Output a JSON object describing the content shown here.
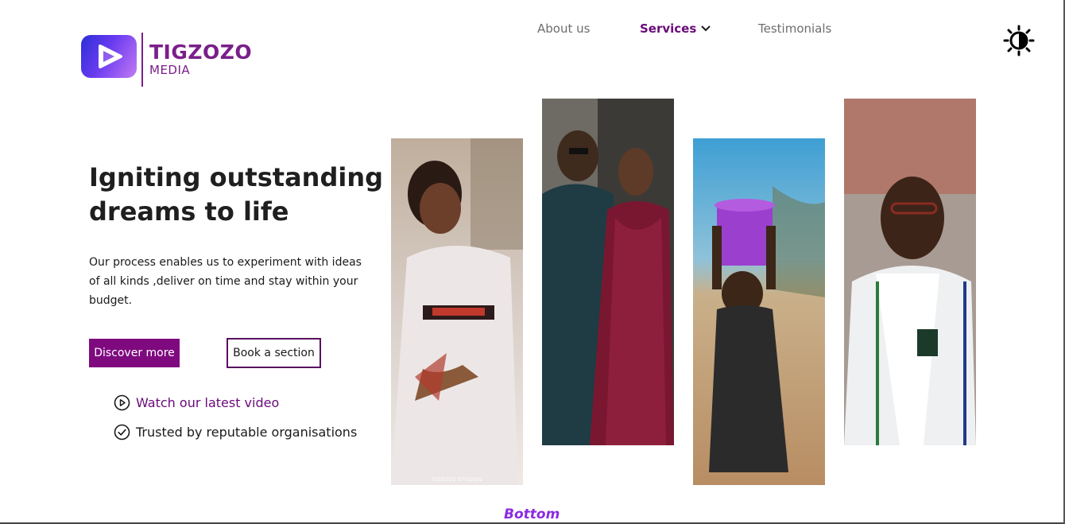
{
  "brand": {
    "name": "TIGZOZO",
    "sub": "MEDIA",
    "color": "#7a1f8a"
  },
  "nav": {
    "items": [
      {
        "label": "About us"
      },
      {
        "label": "Services"
      },
      {
        "label": "Testimonials"
      }
    ],
    "active_color": "#6a0a7a",
    "services_icon": "chevron-down-icon"
  },
  "theme_toggle": {
    "icon": "sun-contrast-icon"
  },
  "hero": {
    "title": "Igniting outstanding dreams to life",
    "description": "Our process enables us to experiment with ideas of all kinds ,deliver on time and stay within your budget.",
    "primary_button": "Discover more",
    "secondary_button": "Book a section",
    "primary_color": "#7f0a7f"
  },
  "features": {
    "watch": {
      "label": "Watch our latest video",
      "icon": "play-circle-icon"
    },
    "trusted": {
      "label": "Trusted by reputable organisations",
      "icon": "check-circle-icon"
    }
  },
  "gallery": {
    "watermark": "TIGZOZO STUDIOS",
    "photos": [
      {
        "subject": "bride-portrait"
      },
      {
        "subject": "couple-portrait"
      },
      {
        "subject": "child-carrying-bucket"
      },
      {
        "subject": "student-in-uniform"
      }
    ]
  },
  "footer_marker": {
    "label": "Bottom",
    "color": "#8a2be2"
  }
}
